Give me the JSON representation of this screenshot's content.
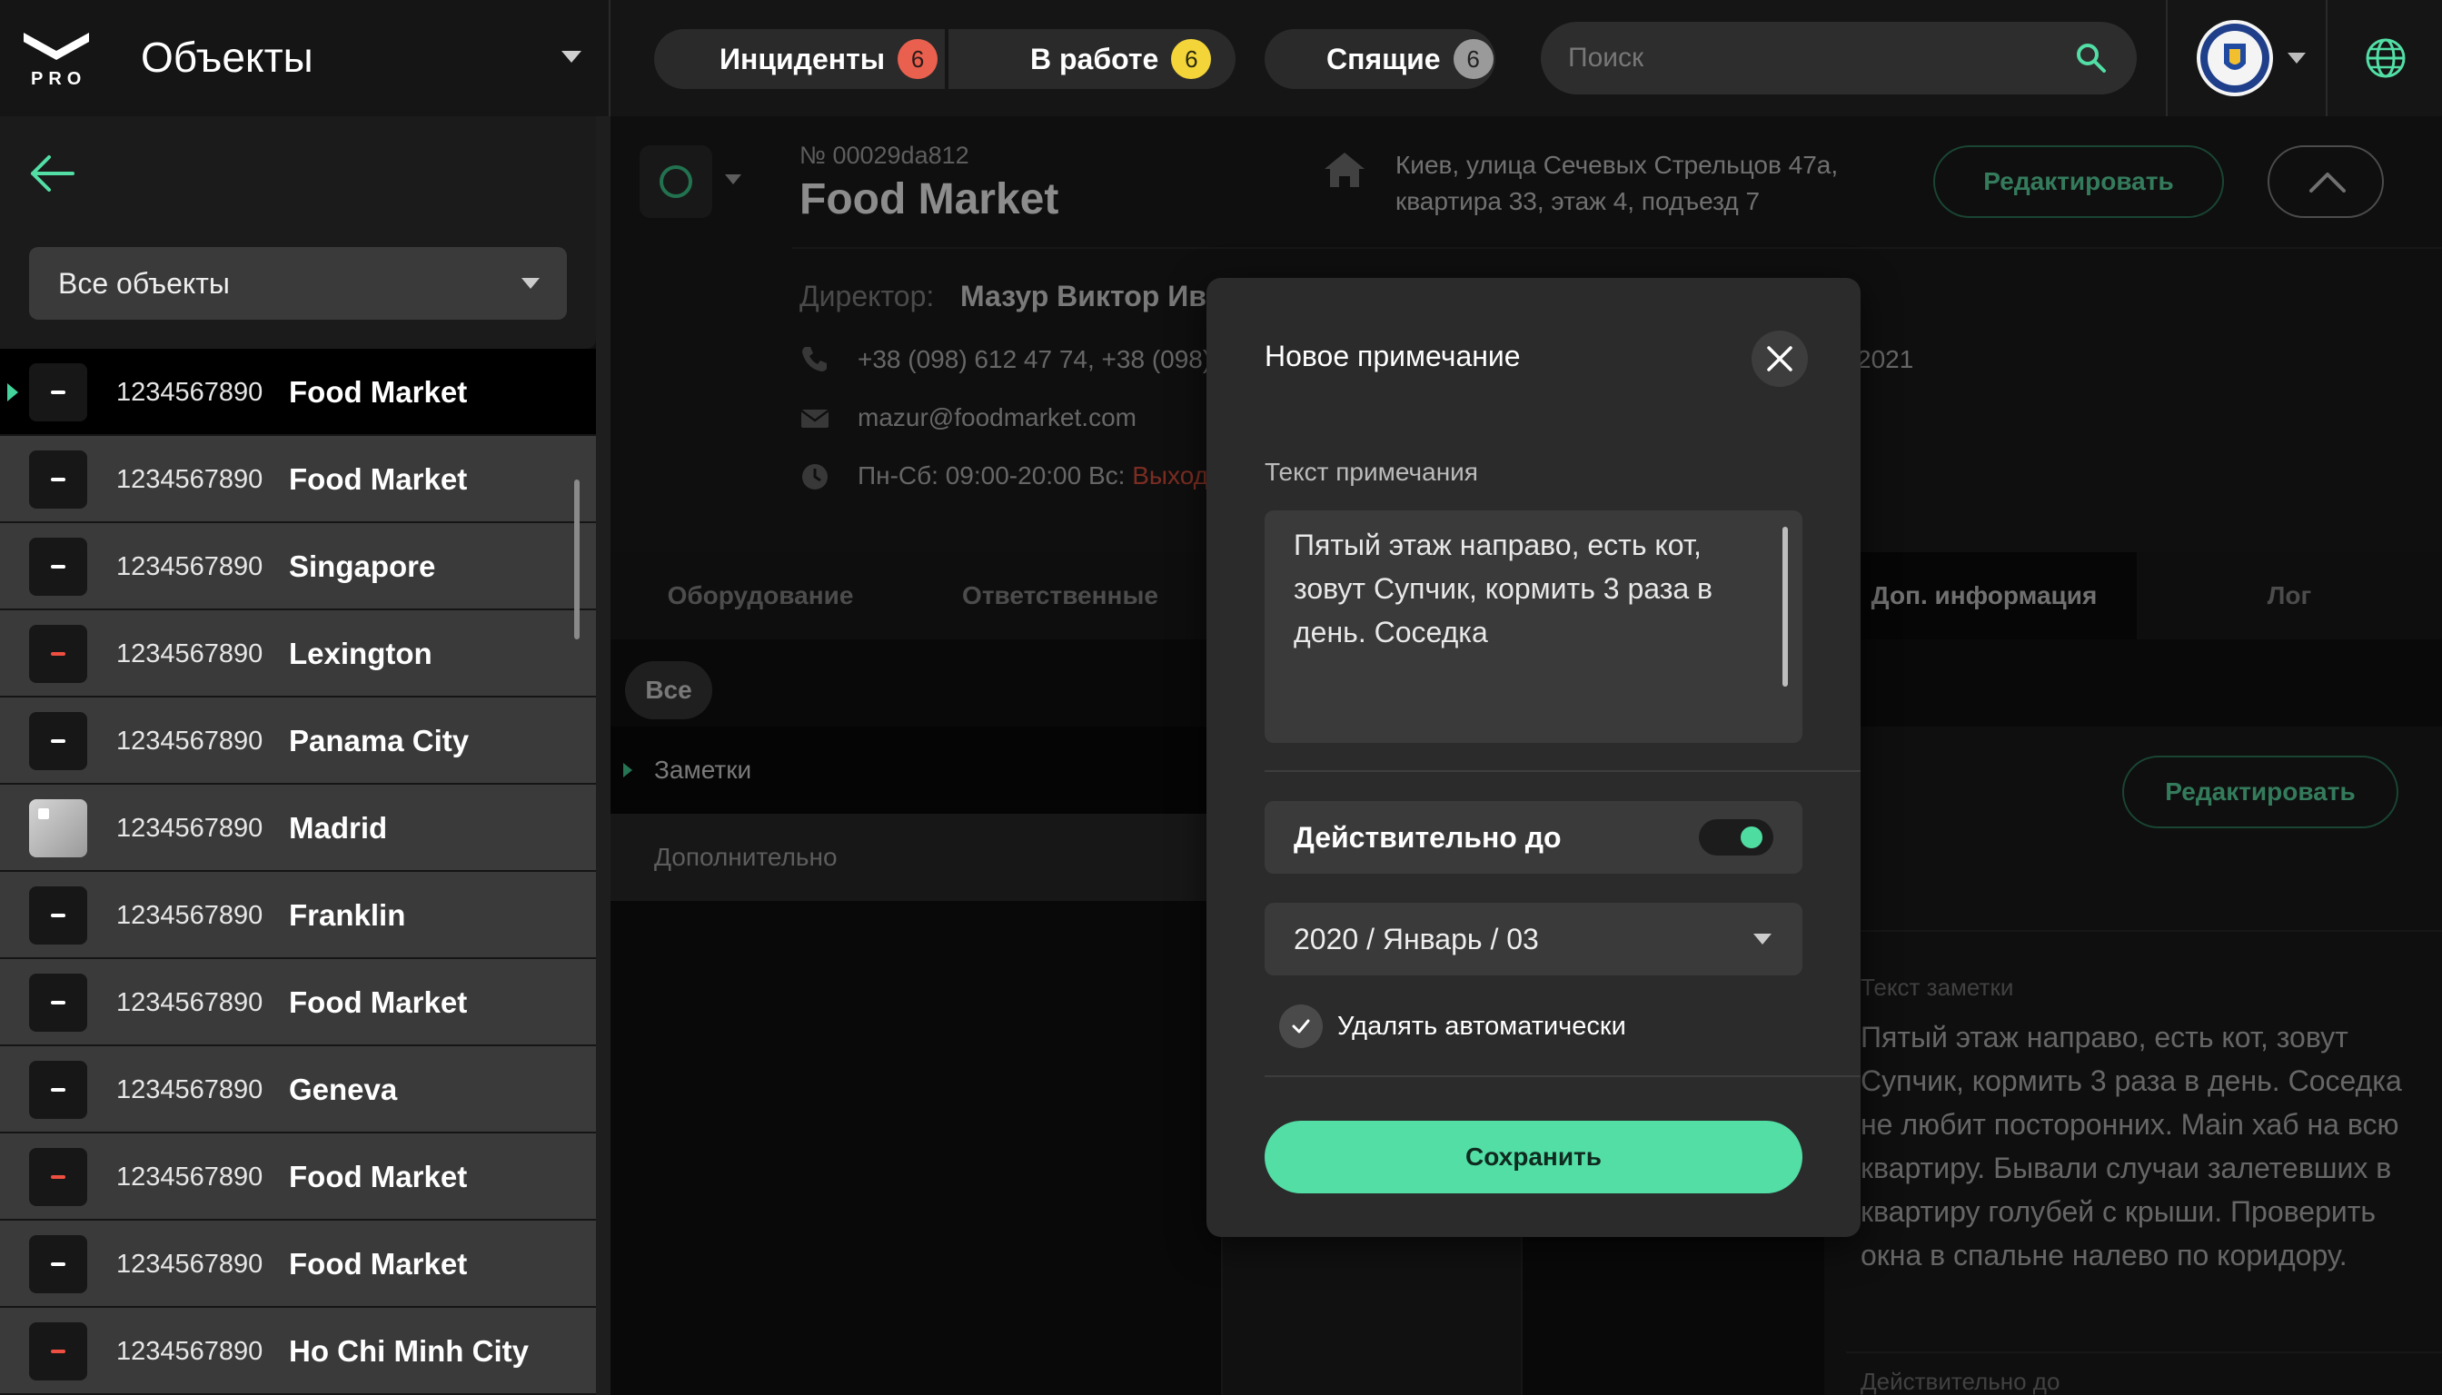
{
  "brand": {
    "sublabel": "PRO",
    "title": "Объекты"
  },
  "header": {
    "counters": [
      {
        "label": "Инциденты",
        "count": "6",
        "color": "#e9604e"
      },
      {
        "label": "В работе",
        "count": "6",
        "color": "#f3d53a"
      },
      {
        "label": "Спящие",
        "count": "6",
        "color": "#9a9a9a"
      }
    ],
    "search": {
      "placeholder": "Поиск",
      "value": ""
    }
  },
  "sidebar": {
    "filter": "Все объекты",
    "objects": [
      {
        "number": "1234567890",
        "name": "Food Market",
        "status": "neutral",
        "active": true
      },
      {
        "number": "1234567890",
        "name": "Food Market",
        "status": "neutral"
      },
      {
        "number": "1234567890",
        "name": "Singapore",
        "status": "neutral"
      },
      {
        "number": "1234567890",
        "name": "Lexington",
        "status": "alarm"
      },
      {
        "number": "1234567890",
        "name": "Panama City",
        "status": "neutral"
      },
      {
        "number": "1234567890",
        "name": "Madrid",
        "status": "photo"
      },
      {
        "number": "1234567890",
        "name": "Franklin",
        "status": "neutral"
      },
      {
        "number": "1234567890",
        "name": "Food Market",
        "status": "neutral"
      },
      {
        "number": "1234567890",
        "name": "Geneva",
        "status": "neutral"
      },
      {
        "number": "1234567890",
        "name": "Food Market",
        "status": "alarm"
      },
      {
        "number": "1234567890",
        "name": "Food Market",
        "status": "neutral"
      },
      {
        "number": "1234567890",
        "name": "Ho Chi Minh City",
        "status": "alarm"
      }
    ]
  },
  "object": {
    "id": "№ 00029da812",
    "title": "Food Market",
    "address_line1": "Киев, улица Сечевых Стрельцов 47а,",
    "address_line2": "квартира 33, этаж 4, подъезд 7",
    "edit_label": "Редактировать",
    "director_label": "Директор:",
    "director_name": "Мазур Виктор Ива",
    "phones": "+38 (098) 612 47 74, +38 (098)",
    "email": "mazur@foodmarket.com",
    "hours": "Пн-Сб: 09:00-20:00 Вс: ",
    "hours_dayoff": "Выходн",
    "side_date": "2021"
  },
  "tabs": {
    "equipment": "Оборудование",
    "responsible": "Ответственные",
    "extra_info": "Доп. информация",
    "log": "Лог"
  },
  "content": {
    "chip_all": "Все",
    "notes": "Заметки",
    "additional": "Дополнительно",
    "edit_label": "Редактировать",
    "note_caption": "Текст заметки",
    "note_text": "Пятый этаж направо, есть кот, зовут Супчик, кормить 3 раза в день. Соседка не любит посторонних. Main хаб на всю квартиру. Бывали случаи залетевших в квартиру голубей с крыши. Проверить окна в спальне налево по коридору.",
    "valid_caption": "Действительно до"
  },
  "modal": {
    "title": "Новое примечание",
    "field_label": "Текст примечания",
    "field_value": "Пятый этаж направо, есть кот, зовут Супчик, кормить 3 раза в день. Соседка",
    "valid_label": "Действительно до",
    "valid_enabled": true,
    "date_value": "2020 / Январь / 03",
    "auto_delete_label": "Удалять автоматически",
    "auto_delete_checked": true,
    "save_label": "Сохранить"
  },
  "colors": {
    "accent": "#52dea5",
    "alarm": "#ef4f40"
  }
}
